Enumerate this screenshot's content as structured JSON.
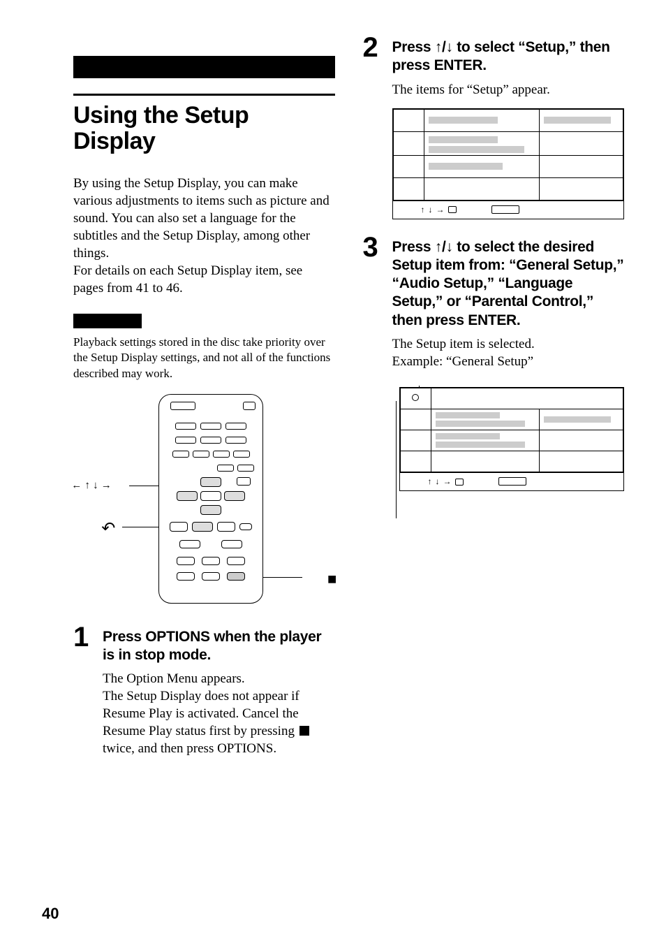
{
  "page_number": "40",
  "chapter_title": "Using the Setup Display",
  "intro_p1": "By using the Setup Display, you can make various adjustments to items such as picture and sound. You can also set a language for the subtitles and the Setup Display, among other things.",
  "intro_p2": "For details on each Setup Display item, see pages from 41 to 46.",
  "note_text": "Playback settings stored in the disc take priority over the Setup Display settings, and not all of the functions described may work.",
  "remote_annotations": {
    "left_arrows": "← ↑ ↓ →",
    "return": "↶",
    "stop": "■"
  },
  "step1": {
    "num": "1",
    "head": "Press OPTIONS when the player is in stop mode.",
    "text_before": "The Option Menu appears.\nThe Setup Display does not appear if Resume Play is activated. Cancel the Resume Play status first by pressing ",
    "text_after": " twice, and then press OPTIONS."
  },
  "step2": {
    "num": "2",
    "head_before": "Press ",
    "head_arrows": "↑/↓",
    "head_after": " to select “Setup,” then press ENTER.",
    "text": "The items for “Setup” appear."
  },
  "step3": {
    "num": "3",
    "head_before": "Press ",
    "head_arrows": "↑/↓",
    "head_after": " to select the desired Setup item from: “General Setup,” “Audio Setup,” “Language Setup,” or “Parental Control,” then press ENTER.",
    "text": "The Setup item is selected.\nExample: “General Setup”"
  },
  "menu_footer_arrows": "↑ ↓ →"
}
